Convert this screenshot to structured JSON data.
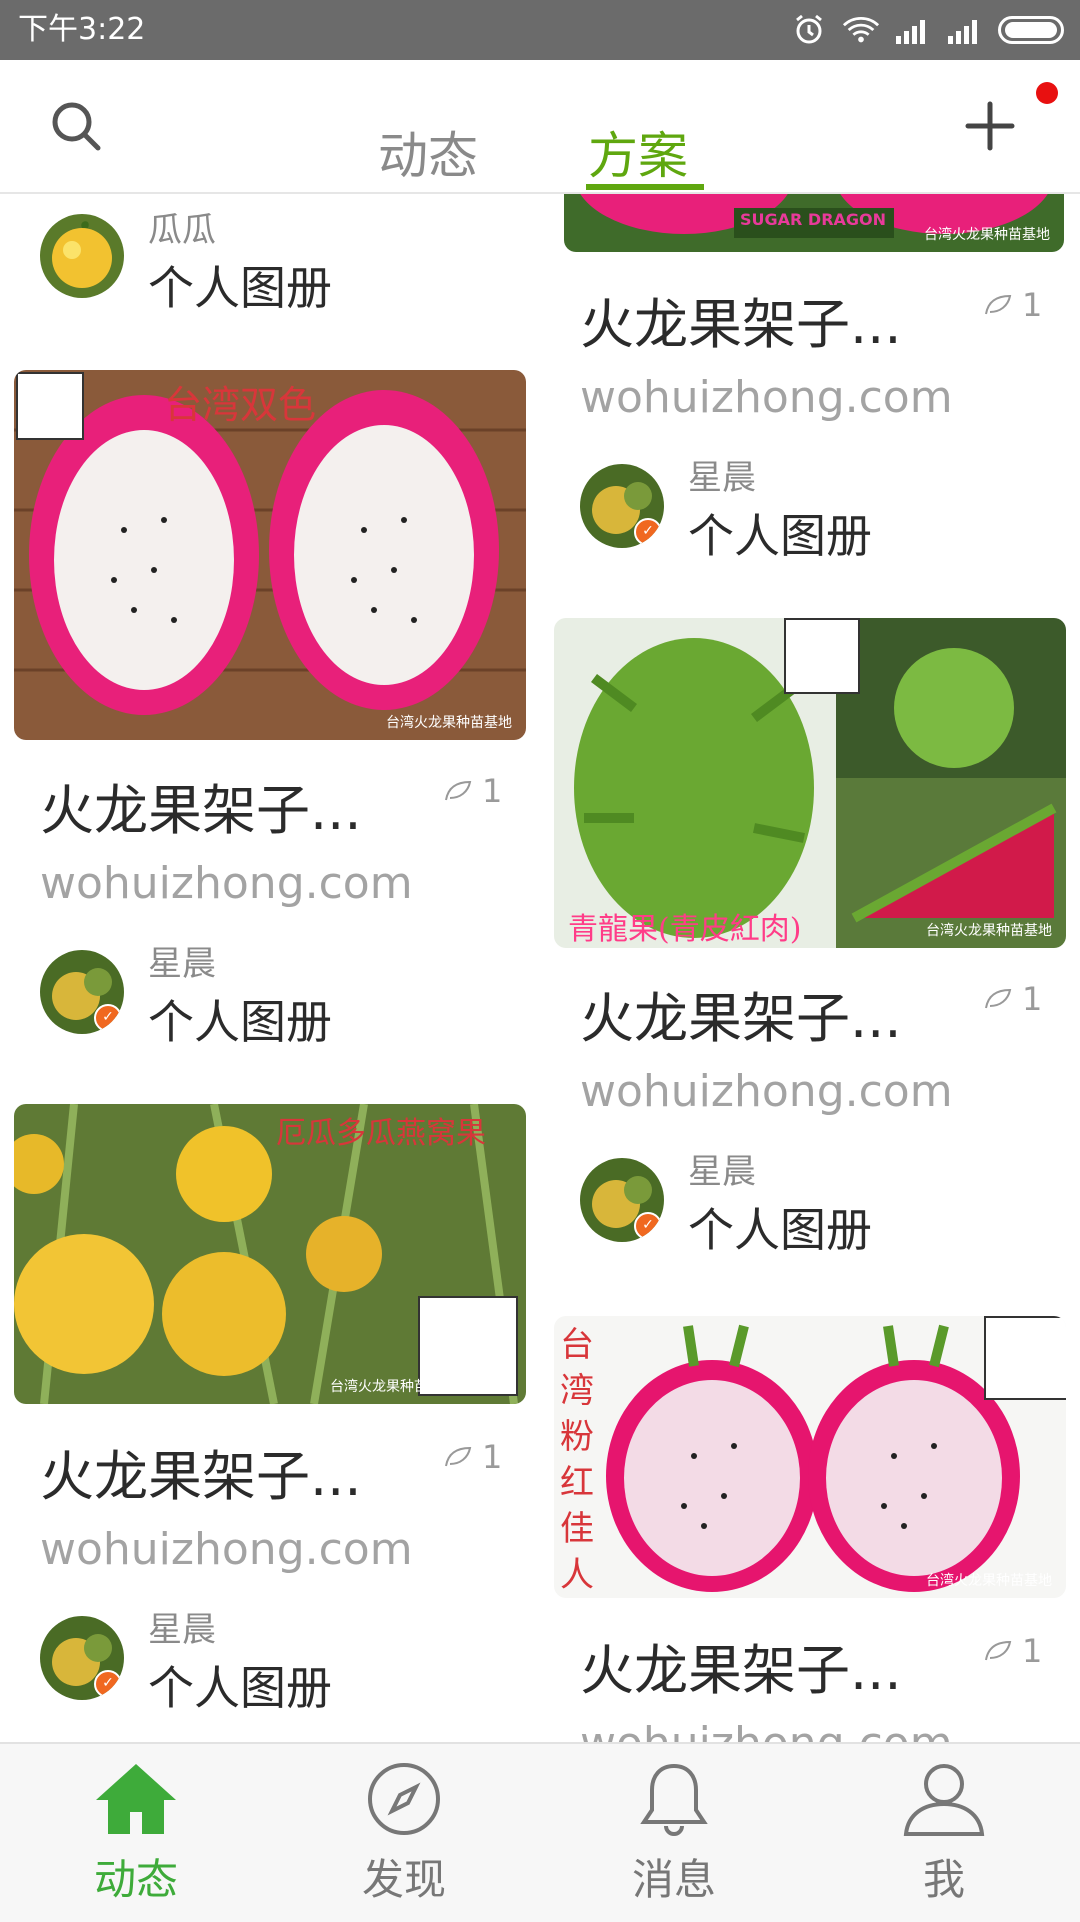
{
  "status": {
    "time": "下午3:22"
  },
  "header": {
    "tabs": [
      {
        "label": "动态",
        "active": false
      },
      {
        "label": "方案",
        "active": true
      }
    ],
    "accent": "#5fa70f"
  },
  "top_author": {
    "name": "瓜瓜",
    "album": "个人图册"
  },
  "cards": [
    {
      "title": "火龙果架子...",
      "count": "1",
      "domain": "wohuizhong.com",
      "author": "星晨",
      "album": "个人图册",
      "caption": "台湾双色",
      "watermark": "台湾火龙果种苗基地"
    },
    {
      "title": "火龙果架子...",
      "count": "1",
      "domain": "wohuizhong.com",
      "author": "星晨",
      "album": "个人图册",
      "caption": "厄瓜多瓜燕窝果",
      "watermark": "台湾火龙果种苗基地"
    },
    {
      "title": "火龙果架子...",
      "count": "1",
      "domain": "wohuizhong.com",
      "author": "星晨",
      "album": "个人图册",
      "caption": "SUGAR DRAGON",
      "watermark": "台湾火龙果种苗基地"
    },
    {
      "title": "火龙果架子...",
      "count": "1",
      "domain": "wohuizhong.com",
      "author": "星晨",
      "album": "个人图册",
      "caption": "青龍果(青皮紅肉)",
      "watermark": "台湾火龙果种苗基地"
    },
    {
      "title": "火龙果架子...",
      "count": "1",
      "domain": "wohuizhong.com",
      "caption": "台湾粉红佳人",
      "watermark": "台湾火龙果种苗基地"
    }
  ],
  "bottom_nav": [
    {
      "label": "动态",
      "icon": "home-icon",
      "active": true
    },
    {
      "label": "发现",
      "icon": "compass-icon",
      "active": false
    },
    {
      "label": "消息",
      "icon": "bell-icon",
      "active": false
    },
    {
      "label": "我",
      "icon": "person-icon",
      "active": false
    }
  ]
}
